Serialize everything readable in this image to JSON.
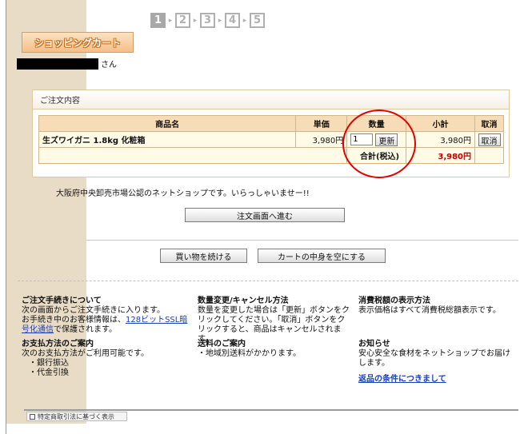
{
  "steps": [
    "1",
    "2",
    "3",
    "4",
    "5"
  ],
  "cart_logo": "ショッピングカート",
  "user": {
    "suffix": "さん"
  },
  "order": {
    "heading": "ご注文内容",
    "columns": {
      "product": "商品名",
      "unit_price": "単価",
      "quantity": "数量",
      "subtotal": "小計",
      "cancel": "取消"
    },
    "item": {
      "name": "生ズワイガニ 1.8kg 化粧箱",
      "unit_price": "3,980円",
      "quantity": "1",
      "update_button": "更新",
      "subtotal": "3,980円",
      "cancel_button": "取消"
    },
    "total_label": "合計(税込)",
    "total_value": "3,980円"
  },
  "welcome_text": "大阪府中央卸売市場公認のネットショップです。いらっしゃいませー!!",
  "buttons": {
    "proceed": "注文画面へ進む",
    "continue": "買い物を続ける",
    "empty_cart": "カートの中身を空にする"
  },
  "info": {
    "order_proc": {
      "title": "ご注文手続きについて",
      "line1": "次の画面からご注文手続きに入ります。",
      "line2a": "お手続き中のお客様情報は、",
      "link": "128ビットSSL暗号化通信",
      "line2b": "で保護されます。"
    },
    "quantity_change": {
      "title": "数量変更/キャンセル方法",
      "text": "数量を変更した場合は「更新」ボタンをクリックしてください。「取消」ボタンをクリックすると、商品はキャンセルされます。"
    },
    "tax": {
      "title": "消費税額の表示方法",
      "text": "表示価格はすべて消費税総額表示です。"
    },
    "payment": {
      "title": "お支払方法のご案内",
      "text": "次のお支払方法がご利用可能です。",
      "methods": [
        "・銀行振込",
        "・代金引換"
      ]
    },
    "shipping": {
      "title": "送料のご案内",
      "text": "・地域別送料がかかります。"
    },
    "notice": {
      "title": "お知らせ",
      "text": "安心安全な食材をネットショップでお届けします。",
      "link": "返品の条件につきまして"
    }
  },
  "footer_badge": "特定商取引法に基づく表示"
}
